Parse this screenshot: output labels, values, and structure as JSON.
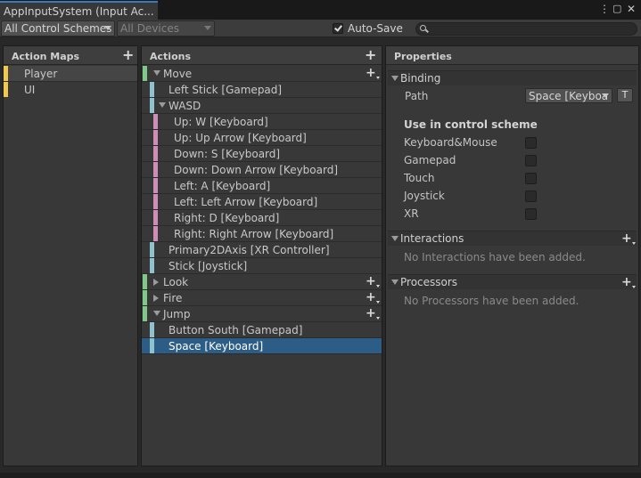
{
  "window": {
    "tab_title": "AppInputSystem (Input Ac...",
    "menu_icon": "kebab-menu-icon",
    "maximize_icon": "maximize-icon",
    "close_icon": "close-icon"
  },
  "toolbar": {
    "control_scheme": "All Control Schemes",
    "devices": "All Devices",
    "auto_save_label": "Auto-Save",
    "auto_save_checked": true,
    "search_value": ""
  },
  "action_maps": {
    "header": "Action Maps",
    "items": [
      {
        "label": "Player",
        "selected": true,
        "color": "#f2c74e"
      },
      {
        "label": "UI",
        "selected": false,
        "color": "#f2c74e"
      }
    ]
  },
  "actions": {
    "header": "Actions",
    "rows": [
      {
        "label": "Move",
        "kind": "action",
        "expanded": true,
        "color": "#7fc88a",
        "indent": 0
      },
      {
        "label": "Left Stick [Gamepad]",
        "kind": "binding",
        "color": "#8fc1cf",
        "indent": 1
      },
      {
        "label": "WASD",
        "kind": "composite",
        "expanded": true,
        "color": "#8fc1cf",
        "indent": 1
      },
      {
        "label": "Up: W [Keyboard]",
        "kind": "part",
        "color": "#d08cb8",
        "indent": 2
      },
      {
        "label": "Up: Up Arrow [Keyboard]",
        "kind": "part",
        "color": "#d08cb8",
        "indent": 2
      },
      {
        "label": "Down: S [Keyboard]",
        "kind": "part",
        "color": "#d08cb8",
        "indent": 2
      },
      {
        "label": "Down: Down Arrow [Keyboard]",
        "kind": "part",
        "color": "#d08cb8",
        "indent": 2
      },
      {
        "label": "Left: A [Keyboard]",
        "kind": "part",
        "color": "#d08cb8",
        "indent": 2
      },
      {
        "label": "Left: Left Arrow [Keyboard]",
        "kind": "part",
        "color": "#d08cb8",
        "indent": 2
      },
      {
        "label": "Right: D [Keyboard]",
        "kind": "part",
        "color": "#d08cb8",
        "indent": 2
      },
      {
        "label": "Right: Right Arrow [Keyboard]",
        "kind": "part",
        "color": "#d08cb8",
        "indent": 2
      },
      {
        "label": "Primary2DAxis [XR Controller]",
        "kind": "binding",
        "color": "#8fc1cf",
        "indent": 1
      },
      {
        "label": "Stick [Joystick]",
        "kind": "binding",
        "color": "#8fc1cf",
        "indent": 1
      },
      {
        "label": "Look",
        "kind": "action",
        "expanded": false,
        "color": "#7fc88a",
        "indent": 0
      },
      {
        "label": "Fire",
        "kind": "action",
        "expanded": false,
        "color": "#7fc88a",
        "indent": 0
      },
      {
        "label": "Jump",
        "kind": "action",
        "expanded": true,
        "color": "#7fc88a",
        "indent": 0
      },
      {
        "label": "Button South [Gamepad]",
        "kind": "binding",
        "color": "#8fc1cf",
        "indent": 1
      },
      {
        "label": "Space [Keyboard]",
        "kind": "binding",
        "color": "#8fc1cf",
        "indent": 1,
        "selected": true
      }
    ]
  },
  "properties": {
    "header": "Properties",
    "binding": {
      "title": "Binding",
      "path_label": "Path",
      "path_value": "Space [Keyboa",
      "t_button": "T",
      "scheme_title": "Use in control scheme",
      "schemes": [
        {
          "label": "Keyboard&Mouse",
          "checked": false
        },
        {
          "label": "Gamepad",
          "checked": false
        },
        {
          "label": "Touch",
          "checked": false
        },
        {
          "label": "Joystick",
          "checked": false
        },
        {
          "label": "XR",
          "checked": false
        }
      ]
    },
    "interactions": {
      "title": "Interactions",
      "empty": "No Interactions have been added."
    },
    "processors": {
      "title": "Processors",
      "empty": "No Processors have been added."
    }
  }
}
